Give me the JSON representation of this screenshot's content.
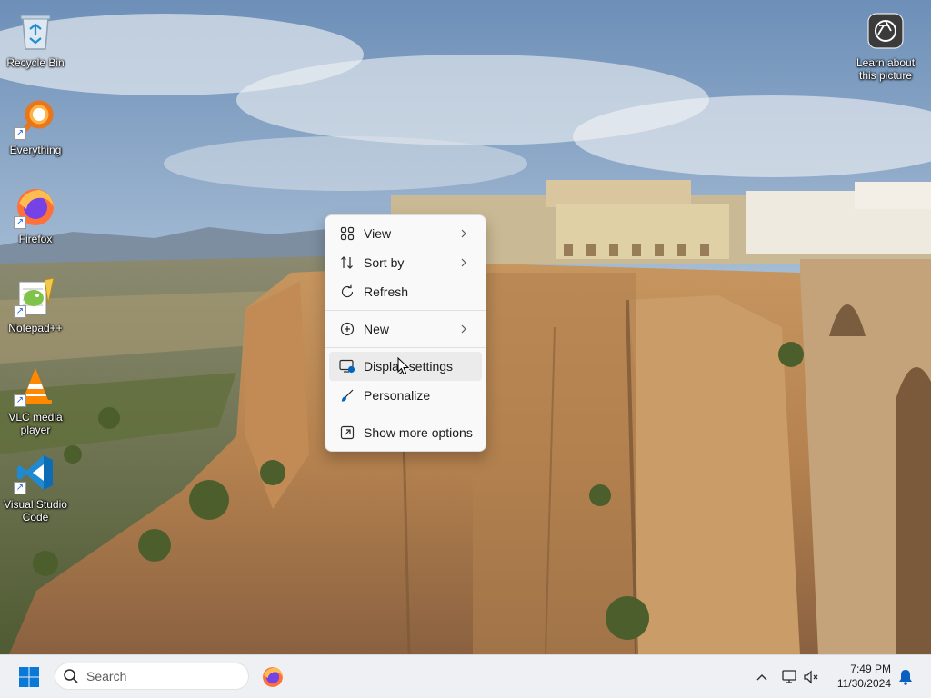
{
  "desktop": {
    "icons": [
      {
        "label": "Recycle Bin",
        "icon": "recycle-bin-icon"
      },
      {
        "label": "Everything",
        "icon": "everything-search-icon"
      },
      {
        "label": "Firefox",
        "icon": "firefox-icon"
      },
      {
        "label": "Notepad++",
        "icon": "notepadpp-icon"
      },
      {
        "label": "VLC media player",
        "icon": "vlc-icon"
      },
      {
        "label": "Visual Studio Code",
        "icon": "vscode-icon"
      }
    ],
    "learn_about": {
      "label": "Learn about this picture",
      "icon": "camera-info-icon"
    }
  },
  "context_menu": {
    "items": [
      {
        "label": "View",
        "icon": "grid-icon",
        "submenu": true
      },
      {
        "label": "Sort by",
        "icon": "sort-icon",
        "submenu": true
      },
      {
        "label": "Refresh",
        "icon": "refresh-icon",
        "submenu": false
      },
      {
        "label": "New",
        "icon": "plus-circle-icon",
        "submenu": true
      },
      {
        "label": "Display settings",
        "icon": "display-settings-icon",
        "submenu": false,
        "hovered": true
      },
      {
        "label": "Personalize",
        "icon": "brush-icon",
        "submenu": false
      },
      {
        "label": "Show more options",
        "icon": "expand-icon",
        "submenu": false
      }
    ]
  },
  "taskbar": {
    "search_placeholder": "Search",
    "pinned_apps": [
      {
        "name": "Firefox",
        "icon": "firefox-icon"
      }
    ],
    "clock": {
      "time": "7:49 PM",
      "date": "11/30/2024"
    }
  },
  "colors": {
    "accent": "#0067c0",
    "taskbar_bg": "#eef0f4",
    "menu_bg": "#f9f9f9",
    "menu_hover": "#ebebeb"
  }
}
